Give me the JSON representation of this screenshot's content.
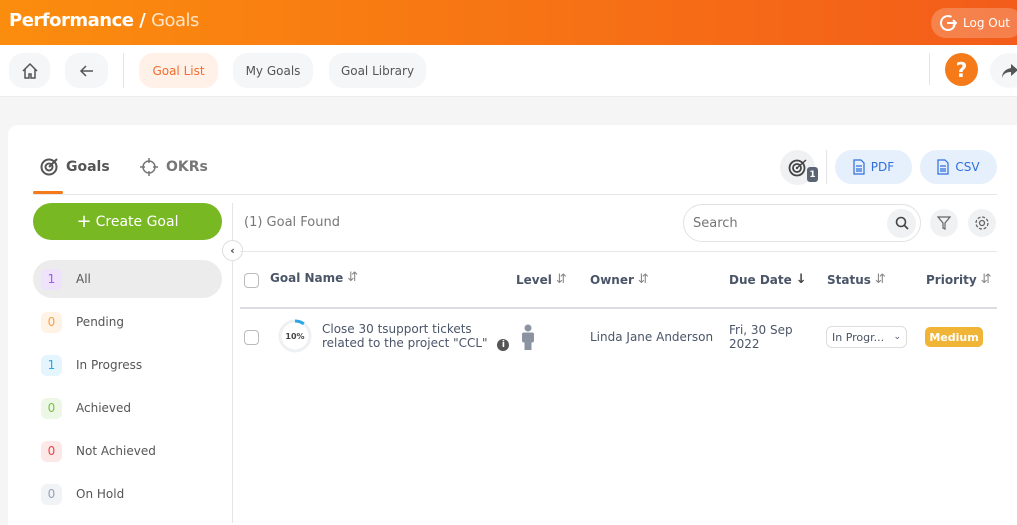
{
  "header": {
    "title": "Performance",
    "subtitle": "Goals",
    "logout": "Log Out"
  },
  "toolbar": {
    "tabs": [
      {
        "label": "Goal List",
        "active": true
      },
      {
        "label": "My Goals"
      },
      {
        "label": "Goal Library"
      }
    ],
    "help": "?"
  },
  "tabs": [
    {
      "label": "Goals",
      "active": true
    },
    {
      "label": "OKRs"
    }
  ],
  "actions": {
    "goal_badge": "1",
    "pdf": "PDF",
    "csv": "CSV"
  },
  "sidebar": {
    "create": "Create Goal",
    "items": [
      {
        "count": "1",
        "label": "All",
        "color": "#a855f7",
        "bg": "#efe3fb",
        "active": true
      },
      {
        "count": "0",
        "label": "Pending",
        "color": "#f5a04a",
        "bg": "#fff3e6"
      },
      {
        "count": "1",
        "label": "In Progress",
        "color": "#2aa6e8",
        "bg": "#e5f5fd"
      },
      {
        "count": "0",
        "label": "Achieved",
        "color": "#7bc043",
        "bg": "#edf7e6"
      },
      {
        "count": "0",
        "label": "Not Achieved",
        "color": "#ef4444",
        "bg": "#fde8e8"
      },
      {
        "count": "0",
        "label": "On Hold",
        "color": "#94a3b8",
        "bg": "#f1f3f6"
      }
    ]
  },
  "main": {
    "found": "(1) Goal Found",
    "search_placeholder": "Search",
    "columns": [
      "Goal Name",
      "Level",
      "Owner",
      "Due Date",
      "Status",
      "Priority"
    ],
    "rows": [
      {
        "progress": "10%",
        "progress_value": 10,
        "name_line1": "Close 30 tsupport tickets",
        "name_line2": "related to the project \"CCL\"",
        "owner": "Linda Jane Anderson",
        "due_line1": "Fri, 30 Sep",
        "due_line2": "2022",
        "status": "In Progr...",
        "priority": "Medium",
        "priority_color": "#f0b537"
      }
    ]
  }
}
